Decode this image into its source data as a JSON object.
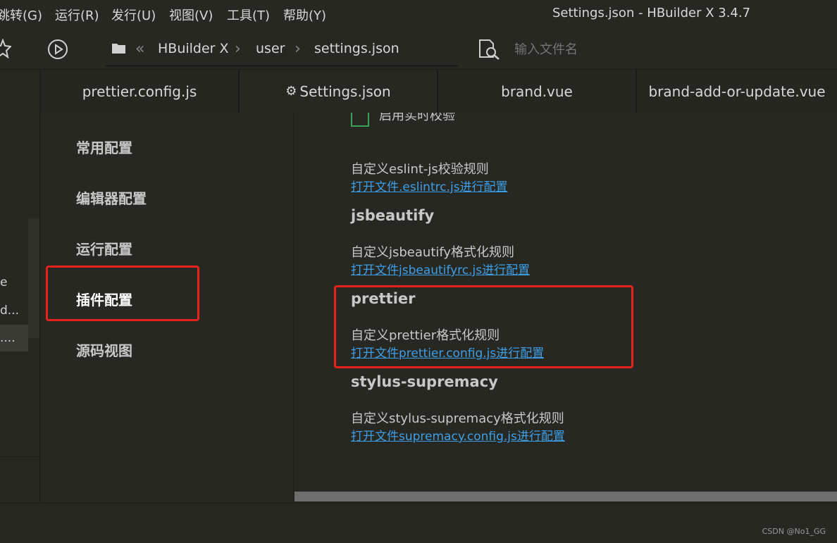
{
  "menu": [
    "跳转(G)",
    "运行(R)",
    "发行(U)",
    "视图(V)",
    "工具(T)",
    "帮助(Y)"
  ],
  "window_title": "Settings.json - HBuilder X 3.4.7",
  "toolbar": {
    "breadcrumb": [
      "HBuilder X",
      "user",
      "settings.json"
    ],
    "search_placeholder": "输入文件名"
  },
  "left_strip": [
    "e",
    "d...",
    "...."
  ],
  "tabs": [
    {
      "label": "prettier.config.js",
      "active": false
    },
    {
      "label": "Settings.json",
      "active": true
    },
    {
      "label": "brand.vue",
      "active": false
    },
    {
      "label": "brand-add-or-update.vue",
      "active": false
    }
  ],
  "settings_nav": [
    "常用配置",
    "编辑器配置",
    "运行配置",
    "插件配置",
    "源码视图"
  ],
  "content": {
    "partial_checkbox_label": "启用实时校验",
    "eslint": {
      "desc": "自定义eslint-js校验规则",
      "link": "打开文件.eslintrc.js进行配置"
    },
    "jsbeautify": {
      "title": "jsbeautify",
      "desc": "自定义jsbeautify格式化规则",
      "link": "打开文件jsbeautifyrc.js进行配置"
    },
    "prettier": {
      "title": "prettier",
      "desc": "自定义prettier格式化规则",
      "link": "打开文件prettier.config.js进行配置"
    },
    "stylus": {
      "title": "stylus-supremacy",
      "desc": "自定义stylus-supremacy格式化规则",
      "link": "打开文件supremacy.config.js进行配置"
    }
  },
  "watermark": "CSDN @No1_GG",
  "colors": {
    "background": "#272822",
    "link": "#3e9fe8",
    "highlight": "#e8231c"
  }
}
